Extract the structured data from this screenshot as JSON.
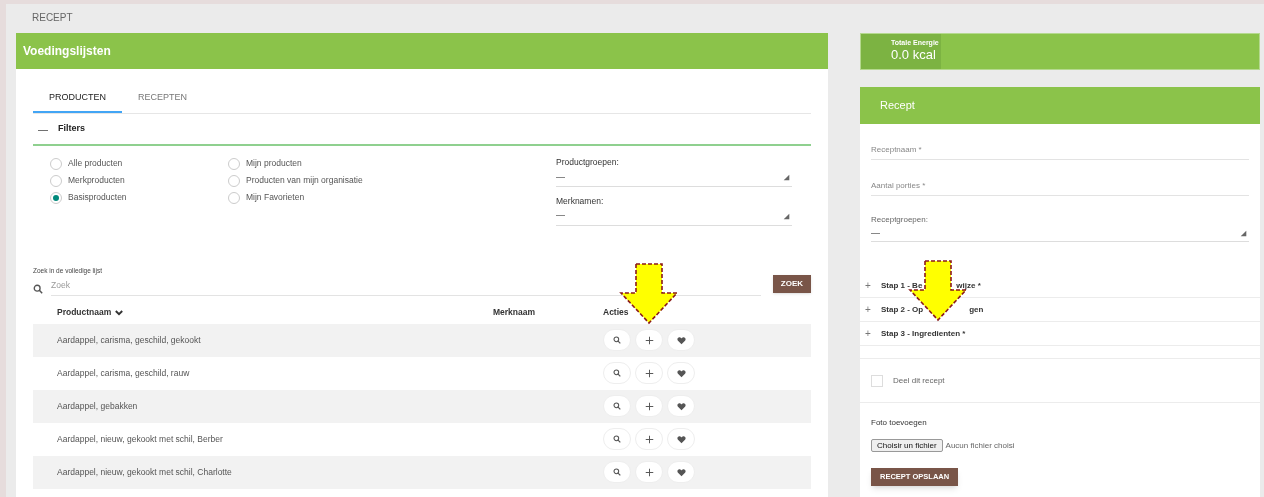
{
  "breadcrumb": "RECEPT",
  "left_panel": {
    "title": "Voedingslijsten",
    "tabs": [
      {
        "label": "PRODUCTEN",
        "selected": true
      },
      {
        "label": "RECEPTEN",
        "selected": false
      }
    ],
    "filters": {
      "toggle": "—",
      "label": "Filters",
      "radios": [
        [
          {
            "label": "Alle producten",
            "selected": false
          },
          {
            "label": "Merkproducten",
            "selected": false
          },
          {
            "label": "Basisproducten",
            "selected": true
          }
        ],
        [
          {
            "label": "Mijn producten",
            "selected": false
          },
          {
            "label": "Producten van mijn organisatie",
            "selected": false
          },
          {
            "label": "Mijn Favorieten",
            "selected": false
          }
        ]
      ],
      "selects": [
        {
          "label": "Productgroepen:",
          "value": "—"
        },
        {
          "label": "Merknamen:",
          "value": "—"
        }
      ]
    },
    "search": {
      "label": "Zoek in de volledige lijst",
      "placeholder": "Zoek",
      "button": "ZOEK"
    },
    "table": {
      "columns": [
        {
          "label": "Productnaam",
          "sort_caret": true
        },
        {
          "label": "Merknaam"
        },
        {
          "label": "Acties"
        }
      ],
      "rows": [
        {
          "name": "Aardappel, carisma, geschild, gekookt"
        },
        {
          "name": "Aardappel, carisma, geschild, rauw"
        },
        {
          "name": "Aardappel, gebakken"
        },
        {
          "name": "Aardappel, nieuw, gekookt met schil, Berber"
        },
        {
          "name": "Aardappel, nieuw, gekookt met schil, Charlotte"
        }
      ]
    }
  },
  "energy": {
    "label": "Totale Energie",
    "value": "0.0 kcal",
    "level": 0.2
  },
  "recipe": {
    "title": "Recept",
    "fields": [
      {
        "kind": "text",
        "placeholder": "Receptnaam *"
      },
      {
        "kind": "text",
        "placeholder": "Aantal porties *"
      },
      {
        "kind": "select",
        "label": "Receptgroepen:",
        "value": "—"
      }
    ],
    "steps": [
      {
        "icon": "+",
        "parts": [
          "Stap 1 - Be",
          "wijze *"
        ]
      },
      {
        "icon": "+",
        "parts": [
          "Stap 2 - Op",
          "gen"
        ]
      },
      {
        "icon": "+",
        "parts": [
          "Stap 3 - Ingredienten *"
        ]
      }
    ],
    "share": {
      "label": "Deel dit recept",
      "checked": false
    },
    "photo": {
      "label": "Foto toevoegen",
      "button": "Choisir un fichier",
      "status": "Aucun fichier choisi"
    },
    "save": "RECEPT OPSLAAN"
  }
}
